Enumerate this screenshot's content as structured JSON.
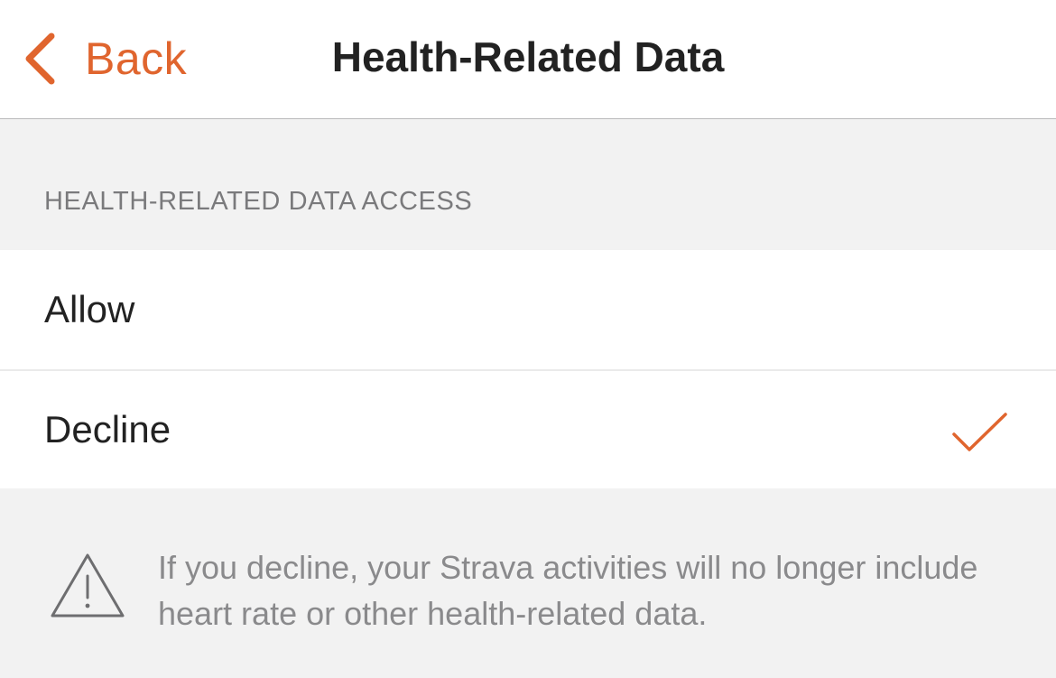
{
  "navbar": {
    "back_label": "Back",
    "title": "Health-Related Data"
  },
  "section": {
    "header": "HEALTH-RELATED DATA ACCESS"
  },
  "options": [
    {
      "label": "Allow",
      "selected": false
    },
    {
      "label": "Decline",
      "selected": true
    }
  ],
  "notice": {
    "icon": "warning-icon",
    "text": "If you decline, your Strava activities will no longer include heart rate or other health-related data."
  },
  "colors": {
    "accent": "#e0652e",
    "background": "#f2f2f2",
    "row_background": "#ffffff",
    "secondary_text": "#7a7a7c",
    "primary_text": "#222222"
  }
}
